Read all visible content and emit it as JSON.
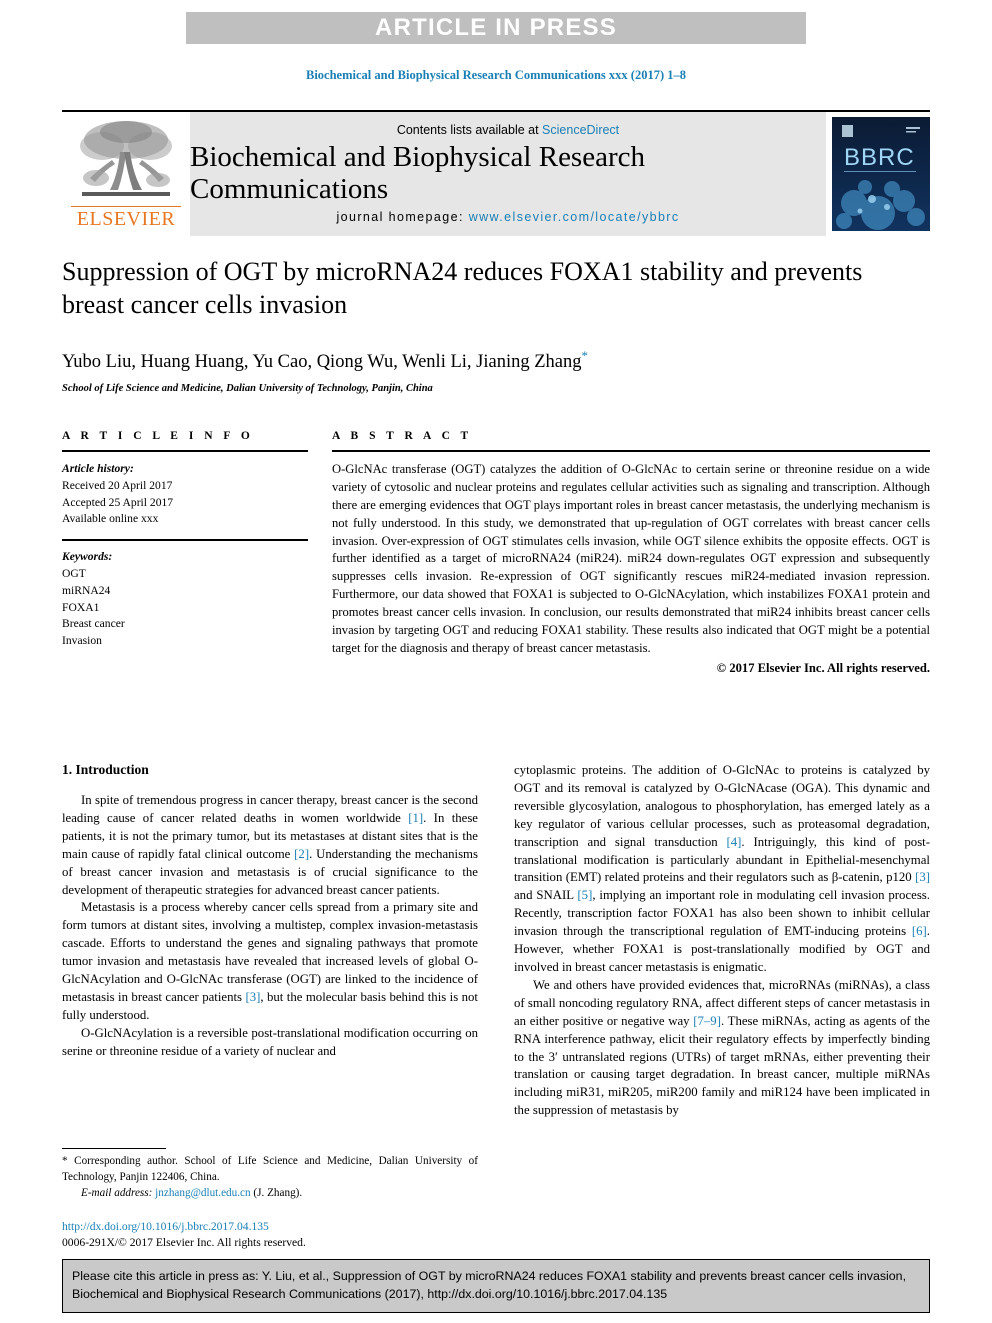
{
  "banner": {
    "text": "ARTICLE IN PRESS",
    "background": "#bfbfbf",
    "text_color": "#ffffff"
  },
  "running_head": "Biochemical and Biophysical Research Communications xxx (2017) 1–8",
  "masthead": {
    "publisher_logo_word": "ELSEVIER",
    "publisher_color": "#e87722",
    "contents_prefix": "Contents lists available at ",
    "contents_link": "ScienceDirect",
    "journal_title": "Biochemical and Biophysical Research Communications",
    "homepage_label": "journal homepage: ",
    "homepage_url": "www.elsevier.com/locate/ybbrc",
    "cover_label": "BBRC",
    "link_color": "#1a7fb5"
  },
  "article": {
    "title": "Suppression of OGT by microRNA24 reduces FOXA1 stability and prevents breast cancer cells invasion",
    "authors": "Yubo Liu, Huang Huang, Yu Cao, Qiong Wu, Wenli Li, Jianing Zhang",
    "corresponding_marker": "*",
    "affiliation": "School of Life Science and Medicine, Dalian University of Technology, Panjin, China"
  },
  "article_info": {
    "heading": "A R T I C L E   I N F O",
    "history_label": "Article history:",
    "history": [
      "Received 20 April 2017",
      "Accepted 25 April 2017",
      "Available online xxx"
    ],
    "keywords_label": "Keywords:",
    "keywords": [
      "OGT",
      "miRNA24",
      "FOXA1",
      "Breast cancer",
      "Invasion"
    ]
  },
  "abstract": {
    "heading": "A B S T R A C T",
    "text": "O-GlcNAc transferase (OGT) catalyzes the addition of O-GlcNAc to certain serine or threonine residue on a wide variety of cytosolic and nuclear proteins and regulates cellular activities such as signaling and transcription. Although there are emerging evidences that OGT plays important roles in breast cancer metastasis, the underlying mechanism is not fully understood. In this study, we demonstrated that up-regulation of OGT correlates with breast cancer cells invasion. Over-expression of OGT stimulates cells invasion, while OGT silence exhibits the opposite effects. OGT is further identified as a target of microRNA24 (miR24). miR24 down-regulates OGT expression and subsequently suppresses cells invasion. Re-expression of OGT significantly rescues miR24-mediated invasion repression. Furthermore, our data showed that FOXA1 is subjected to O-GlcNAcylation, which instabilizes FOXA1 protein and promotes breast cancer cells invasion. In conclusion, our results demonstrated that miR24 inhibits breast cancer cells invasion by targeting OGT and reducing FOXA1 stability. These results also indicated that OGT might be a potential target for the diagnosis and therapy of breast cancer metastasis.",
    "copyright": "© 2017 Elsevier Inc. All rights reserved."
  },
  "introduction": {
    "section_title": "1. Introduction",
    "left_paragraphs": [
      "In spite of tremendous progress in cancer therapy, breast cancer is the second leading cause of cancer related deaths in women worldwide [1]. In these patients, it is not the primary tumor, but its metastases at distant sites that is the main cause of rapidly fatal clinical outcome [2]. Understanding the mechanisms of breast cancer invasion and metastasis is of crucial significance to the development of therapeutic strategies for advanced breast cancer patients.",
      "Metastasis is a process whereby cancer cells spread from a primary site and form tumors at distant sites, involving a multistep, complex invasion-metastasis cascade. Efforts to understand the genes and signaling pathways that promote tumor invasion and metastasis have revealed that increased levels of global O-GlcNAcylation and O-GlcNAc transferase (OGT) are linked to the incidence of metastasis in breast cancer patients [3], but the molecular basis behind this is not fully understood.",
      "O-GlcNAcylation is a reversible post-translational modification occurring on serine or threonine residue of a variety of nuclear and"
    ],
    "right_paragraphs": [
      "cytoplasmic proteins. The addition of O-GlcNAc to proteins is catalyzed by OGT and its removal is catalyzed by O-GlcNAcase (OGA). This dynamic and reversible glycosylation, analogous to phosphorylation, has emerged lately as a key regulator of various cellular processes, such as proteasomal degradation, transcription and signal transduction [4]. Intriguingly, this kind of post-translational modification is particularly abundant in Epithelial-mesenchymal transition (EMT) related proteins and their regulators such as β-catenin, p120 [3] and SNAIL [5], implying an important role in modulating cell invasion process. Recently, transcription factor FOXA1 has also been shown to inhibit cellular invasion through the transcriptional regulation of EMT-inducing proteins [6]. However, whether FOXA1 is post-translationally modified by OGT and involved in breast cancer metastasis is enigmatic.",
      "We and others have provided evidences that, microRNAs (miRNAs), a class of small noncoding regulatory RNA, affect different steps of cancer metastasis in an either positive or negative way [7–9]. These miRNAs, acting as agents of the RNA interference pathway, elicit their regulatory effects by imperfectly binding to the 3′ untranslated regions (UTRs) of target mRNAs, either preventing their translation or causing target degradation. In breast cancer, multiple miRNAs including miR31, miR205, miR200 family and miR124 have been implicated in the suppression of metastasis by"
    ]
  },
  "footnote": {
    "corresponding": "* Corresponding author. School of Life Science and Medicine, Dalian University of Technology, Panjin 122406, China.",
    "email_label": "E-mail address:",
    "email": "jnzhang@dlut.edu.cn",
    "email_suffix": "(J. Zhang).",
    "doi_url": "http://dx.doi.org/10.1016/j.bbrc.2017.04.135",
    "issn_line": "0006-291X/© 2017 Elsevier Inc. All rights reserved."
  },
  "cite_box": {
    "text": "Please cite this article in press as: Y. Liu, et al., Suppression of OGT by microRNA24 reduces FOXA1 stability and prevents breast cancer cells invasion, Biochemical and Biophysical Research Communications (2017), http://dx.doi.org/10.1016/j.bbrc.2017.04.135",
    "background": "#c9c9c9"
  }
}
